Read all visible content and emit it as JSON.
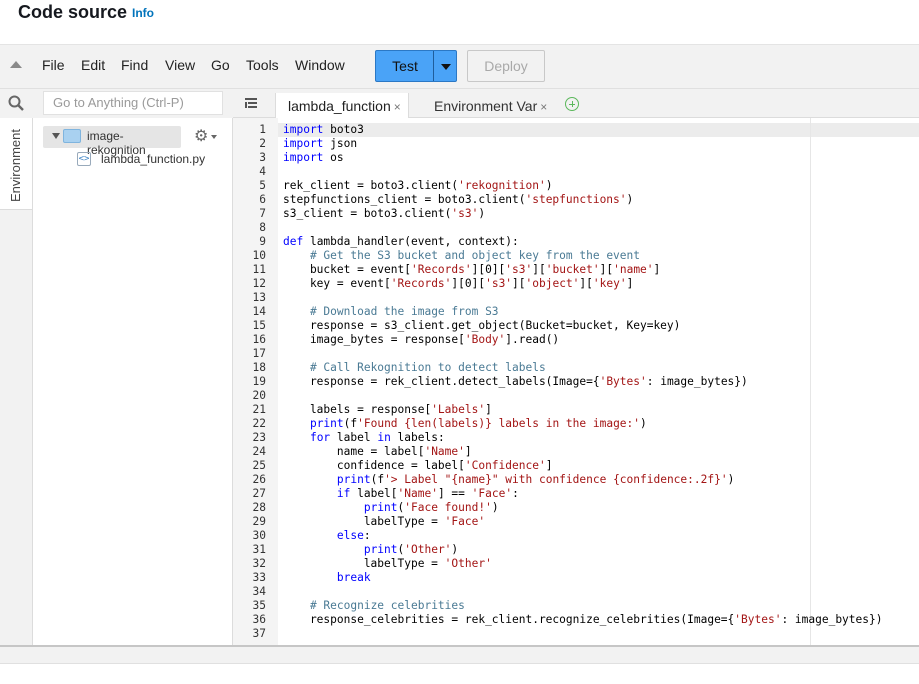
{
  "header": {
    "title": "Code source",
    "info_link": "Info"
  },
  "menu": [
    "File",
    "Edit",
    "Find",
    "View",
    "Go",
    "Tools",
    "Window"
  ],
  "actions": {
    "test_label": "Test",
    "deploy_label": "Deploy"
  },
  "search": {
    "placeholder": "Go to Anything (Ctrl-P)"
  },
  "tabs": [
    {
      "label": "lambda_function",
      "close": "×",
      "active": true
    },
    {
      "label": "Environment Var",
      "close": "×",
      "active": false
    }
  ],
  "sidebar": {
    "environment_tab": "Environment"
  },
  "tree": {
    "folder": "image-rekognition",
    "files": [
      {
        "name": "lambda_function.py",
        "icon": "python-file-icon"
      }
    ]
  },
  "colors": {
    "accent": "#4aa3f7",
    "keyword": "#0000ff",
    "string": "#a31515",
    "comment": "#4a7a94"
  },
  "code_lines": [
    "import boto3",
    "import json",
    "import os",
    "",
    "rek_client = boto3.client('rekognition')",
    "stepfunctions_client = boto3.client('stepfunctions')",
    "s3_client = boto3.client('s3')",
    "",
    "def lambda_handler(event, context):",
    "    # Get the S3 bucket and object key from the event",
    "    bucket = event['Records'][0]['s3']['bucket']['name']",
    "    key = event['Records'][0]['s3']['object']['key']",
    "",
    "    # Download the image from S3",
    "    response = s3_client.get_object(Bucket=bucket, Key=key)",
    "    image_bytes = response['Body'].read()",
    "",
    "    # Call Rekognition to detect labels",
    "    response = rek_client.detect_labels(Image={'Bytes': image_bytes})",
    "",
    "    labels = response['Labels']",
    "    print(f'Found {len(labels)} labels in the image:')",
    "    for label in labels:",
    "        name = label['Name']",
    "        confidence = label['Confidence']",
    "        print(f'> Label \"{name}\" with confidence {confidence:.2f}')",
    "        if label['Name'] == 'Face':",
    "            print('Face found!')",
    "            labelType = 'Face'",
    "        else:",
    "            print('Other')",
    "            labelType = 'Other'",
    "        break",
    "",
    "    # Recognize celebrities",
    "    response_celebrities = rek_client.recognize_celebrities(Image={'Bytes': image_bytes})",
    ""
  ]
}
